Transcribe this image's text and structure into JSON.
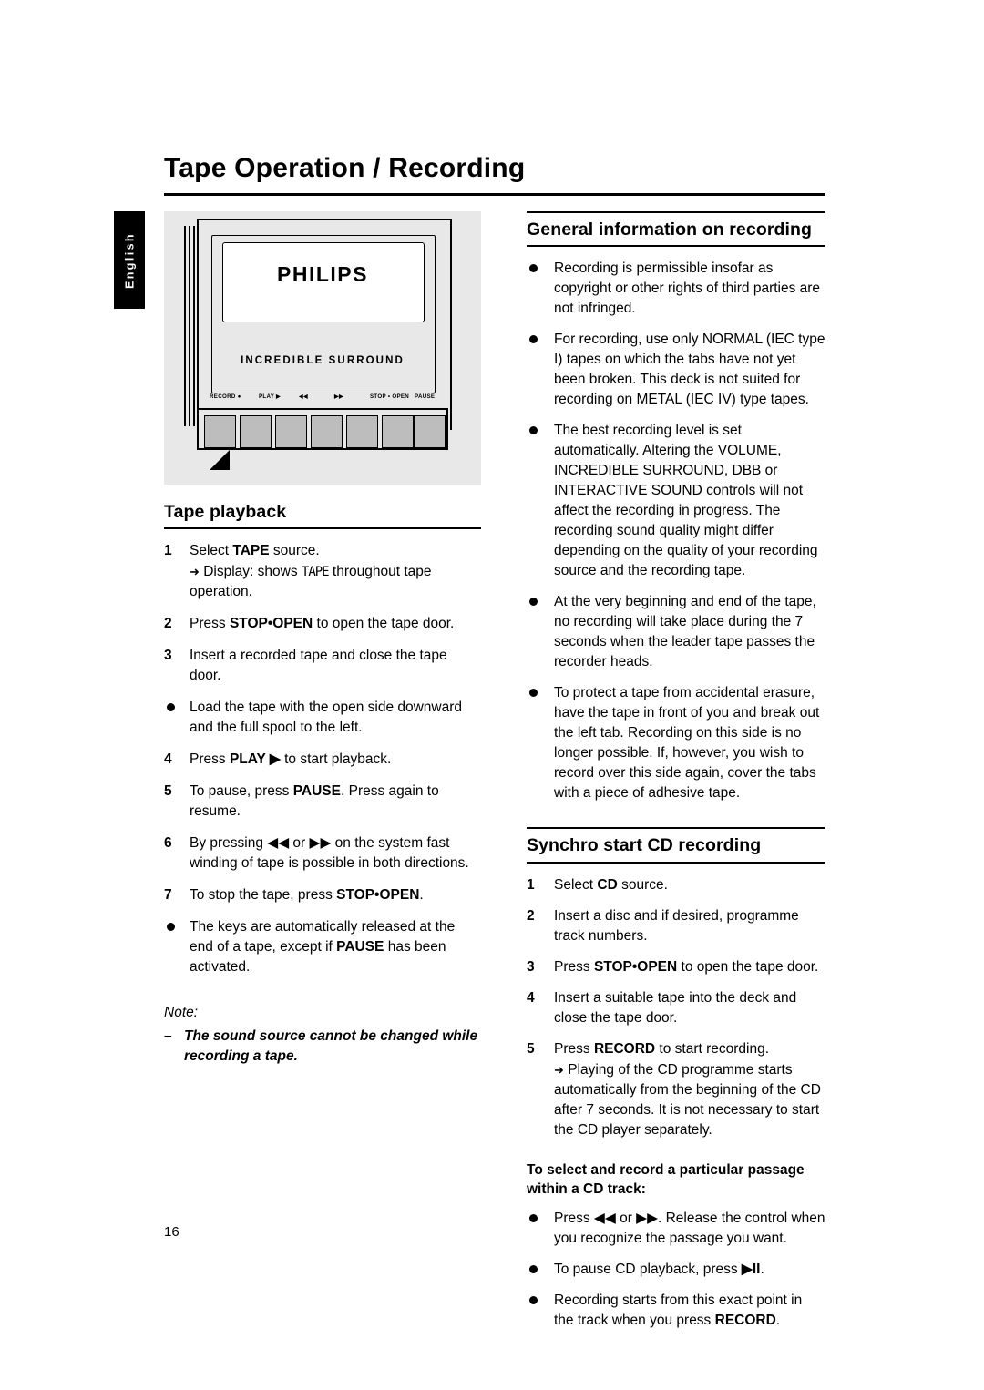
{
  "page": {
    "title": "Tape Operation / Recording",
    "side_tab": "English",
    "page_number": "16"
  },
  "illustration": {
    "brand": "PHILIPS",
    "feature_label": "INCREDIBLE SURROUND",
    "button_labels": [
      "RECORD ●",
      "PLAY ▶",
      "◀◀",
      "▶▶",
      "STOP • OPEN",
      "PAUSE"
    ]
  },
  "tape_playback": {
    "heading": "Tape playback",
    "steps": [
      {
        "num": "1",
        "text": "Select ",
        "bold": "TAPE",
        "text2": " source.",
        "sub_arrow": "➜",
        "sub_pre": " Display: shows ",
        "sub_lcd": "TAPE",
        "sub_post": " throughout tape operation."
      },
      {
        "num": "2",
        "text": "Press ",
        "bold": "STOP•OPEN",
        "text2": " to open the tape door."
      },
      {
        "num": "3",
        "text": "Insert a recorded tape and close the tape door."
      }
    ],
    "bullet_after_3": "Load the tape with the open side downward and the full spool to the left.",
    "steps2": [
      {
        "num": "4",
        "text": "Press ",
        "bold": "PLAY ▶",
        "text2": " to start playback."
      },
      {
        "num": "5",
        "text": "To pause, press ",
        "bold": "PAUSE",
        "text2": ". Press again to resume."
      },
      {
        "num": "6",
        "text": "By pressing ◀◀ or ▶▶ on the system fast winding of tape is possible in both directions."
      },
      {
        "num": "7",
        "text": "To stop the tape, press ",
        "bold": "STOP•OPEN",
        "text2": "."
      }
    ],
    "bullet_end_pre": "The keys are automatically released at the end of a tape, except if ",
    "bullet_end_bold": "PAUSE",
    "bullet_end_post": " has been activated.",
    "note_label": "Note:",
    "note_dash": "–",
    "note_text": "The sound source cannot be changed while recording a tape."
  },
  "general_info": {
    "heading": "General information on recording",
    "bullets": [
      "Recording is permissible insofar as copyright or other rights of third parties are not infringed.",
      "For recording, use only NORMAL (IEC type I) tapes on which the tabs have not yet been broken. This deck is not suited for recording on METAL (IEC IV) type tapes.",
      "The best recording level is set automatically. Altering the VOLUME, INCREDIBLE SURROUND, DBB or INTERACTIVE SOUND controls will not affect the recording in progress. The recording sound quality might differ depending on the quality of your recording source and the recording tape.",
      "At the very beginning and end of the tape, no recording will take place during the 7 seconds when the leader tape passes the recorder heads.",
      "To protect a tape from accidental erasure, have the tape in front of you and break out the left tab. Recording on this side is no longer possible. If, however, you wish to record over this side again, cover the tabs with a piece of adhesive tape."
    ]
  },
  "synchro": {
    "heading": "Synchro start CD recording",
    "steps": [
      {
        "num": "1",
        "text": "Select ",
        "bold": "CD",
        "text2": " source."
      },
      {
        "num": "2",
        "text": "Insert a disc and if desired, programme track numbers."
      },
      {
        "num": "3",
        "text": "Press ",
        "bold": "STOP•OPEN",
        "text2": " to open the tape door."
      },
      {
        "num": "4",
        "text": "Insert a suitable tape into the deck and close the tape door."
      },
      {
        "num": "5",
        "text": "Press ",
        "bold": "RECORD",
        "text2": " to start recording.",
        "sub_arrow": "➜",
        "sub": " Playing of the CD programme starts automatically from the beginning of the CD after 7 seconds. It is not necessary to start the CD player separately."
      }
    ],
    "subheading": "To select and record a particular passage within a CD track:",
    "sub_bullets": [
      {
        "pre": "Press ◀◀ or ▶▶. Release the control when you recognize the passage you want.",
        "bold": "",
        "post": ""
      },
      {
        "pre": "To pause CD playback, press ",
        "bold": "▶II",
        "post": "."
      },
      {
        "pre": "Recording starts from this exact point in the track when you press ",
        "bold": "RECORD",
        "post": "."
      }
    ]
  }
}
